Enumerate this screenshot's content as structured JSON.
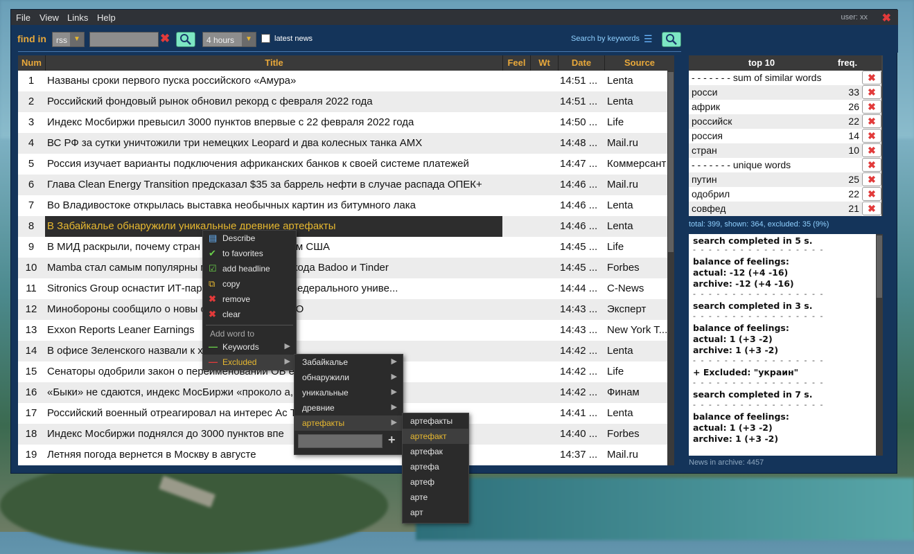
{
  "menubar": {
    "items": [
      "File",
      "View",
      "Links",
      "Help"
    ],
    "user": "user: xx",
    "close": "✖"
  },
  "toolbar": {
    "find_label": "find in",
    "source_select": "rss",
    "search_value": "",
    "clear_icon": "✖",
    "period_select": "4 hours",
    "latest_news_label": "latest news",
    "search_by_keywords": "Search by keywords"
  },
  "table": {
    "headers": {
      "num": "Num",
      "title": "Title",
      "feel": "Feel",
      "wt": "Wt",
      "date": "Date",
      "source": "Source"
    },
    "rows": [
      {
        "num": "1",
        "title": "Названы сроки первого пуска российского «Амура»",
        "date": "14:51 ...",
        "source": "Lenta"
      },
      {
        "num": "2",
        "title": "Российский фондовый рынок обновил рекорд с февраля 2022 года",
        "date": "14:51 ...",
        "source": "Lenta"
      },
      {
        "num": "3",
        "title": "Индекс Мосбиржи превысил 3000 пунктов впервые с 22 февраля 2022 года",
        "date": "14:50 ...",
        "source": "Life"
      },
      {
        "num": "4",
        "title": "ВС РФ за сутки уничтожили три немецких Leopard и два колесных танка AMX",
        "date": "14:48 ...",
        "source": "Mail.ru"
      },
      {
        "num": "5",
        "title": "Россия изучает варианты подключения африканских банков к своей системе платежей",
        "date": "14:47 ...",
        "source": "Коммерсант"
      },
      {
        "num": "6",
        "title": "Глава Clean Energy Transition предсказал $35 за баррель нефти в случае распада ОПЕК+",
        "date": "14:46 ...",
        "source": "Mail.ru"
      },
      {
        "num": "7",
        "title": "Во Владивостоке открылась выставка необычных картин из битумного лака",
        "date": "14:46 ...",
        "source": "Lenta"
      },
      {
        "num": "8",
        "title": "В Забайкалье обнаружили уникальные древние артефакты",
        "date": "14:46 ...",
        "source": "Lenta"
      },
      {
        "num": "9",
        "title": "В МИД раскрыли, почему стран        ли перед давлением США",
        "date": "14:45 ...",
        "source": "Life"
      },
      {
        "num": "10",
        "title": "Mamba стал самым популярны          м в России после ухода Badoo и Tinder",
        "date": "14:45 ...",
        "source": "Forbes"
      },
      {
        "num": "11",
        "title": "Sitronics Group оснастит ИТ-пар           тика» Северного федерального униве...",
        "date": "14:44 ...",
        "source": "C-News"
      },
      {
        "num": "12",
        "title": "Минобороны сообщило о новы            ой армии в зоне СВО",
        "date": "14:43 ...",
        "source": "Эксперт"
      },
      {
        "num": "13",
        "title": "Exxon Reports Leaner Earnings",
        "date": "14:43 ...",
        "source": "New York T..."
      },
      {
        "num": "14",
        "title": "В офисе Зеленского назвали к             х систем Patriot",
        "date": "14:42 ...",
        "source": "Lenta"
      },
      {
        "num": "15",
        "title": "Сенаторы одобрили закон о переименовании ОЬ                         ебряных медале...",
        "date": "14:42 ...",
        "source": "Life"
      },
      {
        "num": "16",
        "title": "«Быки» не сдаются, индекс МосБиржи «проколо                       а, но риски пятни...",
        "date": "14:42 ...",
        "source": "Финам"
      },
      {
        "num": "17",
        "title": "Российский военный отреагировал на интерес Ас                      Торн",
        "date": "14:41 ...",
        "source": "Lenta"
      },
      {
        "num": "18",
        "title": "Индекс Мосбиржи поднялся до 3000 пунктов впе",
        "date": "14:40 ...",
        "source": "Forbes"
      },
      {
        "num": "19",
        "title": "Летняя погода вернется в Москву в августе",
        "date": "14:37 ...",
        "source": "Mail.ru"
      }
    ]
  },
  "top10": {
    "headers": {
      "word": "top 10",
      "freq": "freq."
    },
    "rows": [
      {
        "word": "- - - - - - - sum of similar words",
        "freq": ""
      },
      {
        "word": "росси",
        "freq": "33"
      },
      {
        "word": "африк",
        "freq": "26"
      },
      {
        "word": "российск",
        "freq": "22"
      },
      {
        "word": "россия",
        "freq": "14"
      },
      {
        "word": "стран",
        "freq": "10"
      },
      {
        "word": "- - - - - - - unique words",
        "freq": ""
      },
      {
        "word": "путин",
        "freq": "25"
      },
      {
        "word": "одобрил",
        "freq": "22"
      },
      {
        "word": "совфед",
        "freq": "21"
      }
    ]
  },
  "totals": "total: 399, shown: 364, excluded: 35 (9%)",
  "log": {
    "lines": [
      {
        "t": "search completed in 5 s.",
        "dash": false
      },
      {
        "t": "- - - - - - - - - - - - - - - - -",
        "dash": true
      },
      {
        "t": "balance of feelings:",
        "dash": false
      },
      {
        "t": "actual: -12 (+4 -16)",
        "dash": false
      },
      {
        "t": "archive: -12 (+4 -16)",
        "dash": false
      },
      {
        "t": "- - - - - - - - - - - - - - - - -",
        "dash": true
      },
      {
        "t": "search completed in 3 s.",
        "dash": false
      },
      {
        "t": "- - - - - - - - - - - - - - - - -",
        "dash": true
      },
      {
        "t": "balance of feelings:",
        "dash": false
      },
      {
        "t": "actual: 1 (+3 -2)",
        "dash": false
      },
      {
        "t": "archive: 1 (+3 -2)",
        "dash": false
      },
      {
        "t": "- - - - - - - - - - - - - - - - -",
        "dash": true
      },
      {
        "t": "+ Excluded: \"украин\"",
        "dash": false
      },
      {
        "t": "- - - - - - - - - - - - - - - - -",
        "dash": true
      },
      {
        "t": "search completed in 7 s.",
        "dash": false
      },
      {
        "t": "- - - - - - - - - - - - - - - - -",
        "dash": true
      },
      {
        "t": "balance of feelings:",
        "dash": false
      },
      {
        "t": "actual: 1 (+3 -2)",
        "dash": false
      },
      {
        "t": "archive: 1 (+3 -2)",
        "dash": false
      }
    ]
  },
  "archive": "News in archive: 4457",
  "context_menu": {
    "items": [
      {
        "label": "Describe",
        "icon": "list-icon"
      },
      {
        "label": "to favorites",
        "icon": "check-icon"
      },
      {
        "label": "add headline",
        "icon": "checkbox-icon"
      },
      {
        "label": "copy",
        "icon": "copy-icon"
      },
      {
        "label": "remove",
        "icon": "remove-icon"
      },
      {
        "label": "clear",
        "icon": "clear-icon"
      }
    ],
    "section": "Add word to",
    "keywords": "Keywords",
    "excluded": "Excluded"
  },
  "submenu_words": [
    "Забайкалье",
    "обнаружили",
    "уникальные",
    "древние",
    "артефакты"
  ],
  "submenu_forms": [
    "артефакты",
    "артефакт",
    "артефак",
    "артефа",
    "артеф",
    "арте",
    "арт"
  ],
  "colors": {
    "accent": "#e8b930",
    "window": "#14345a",
    "danger": "#e23a3a",
    "search_button": "#7de7c4"
  }
}
